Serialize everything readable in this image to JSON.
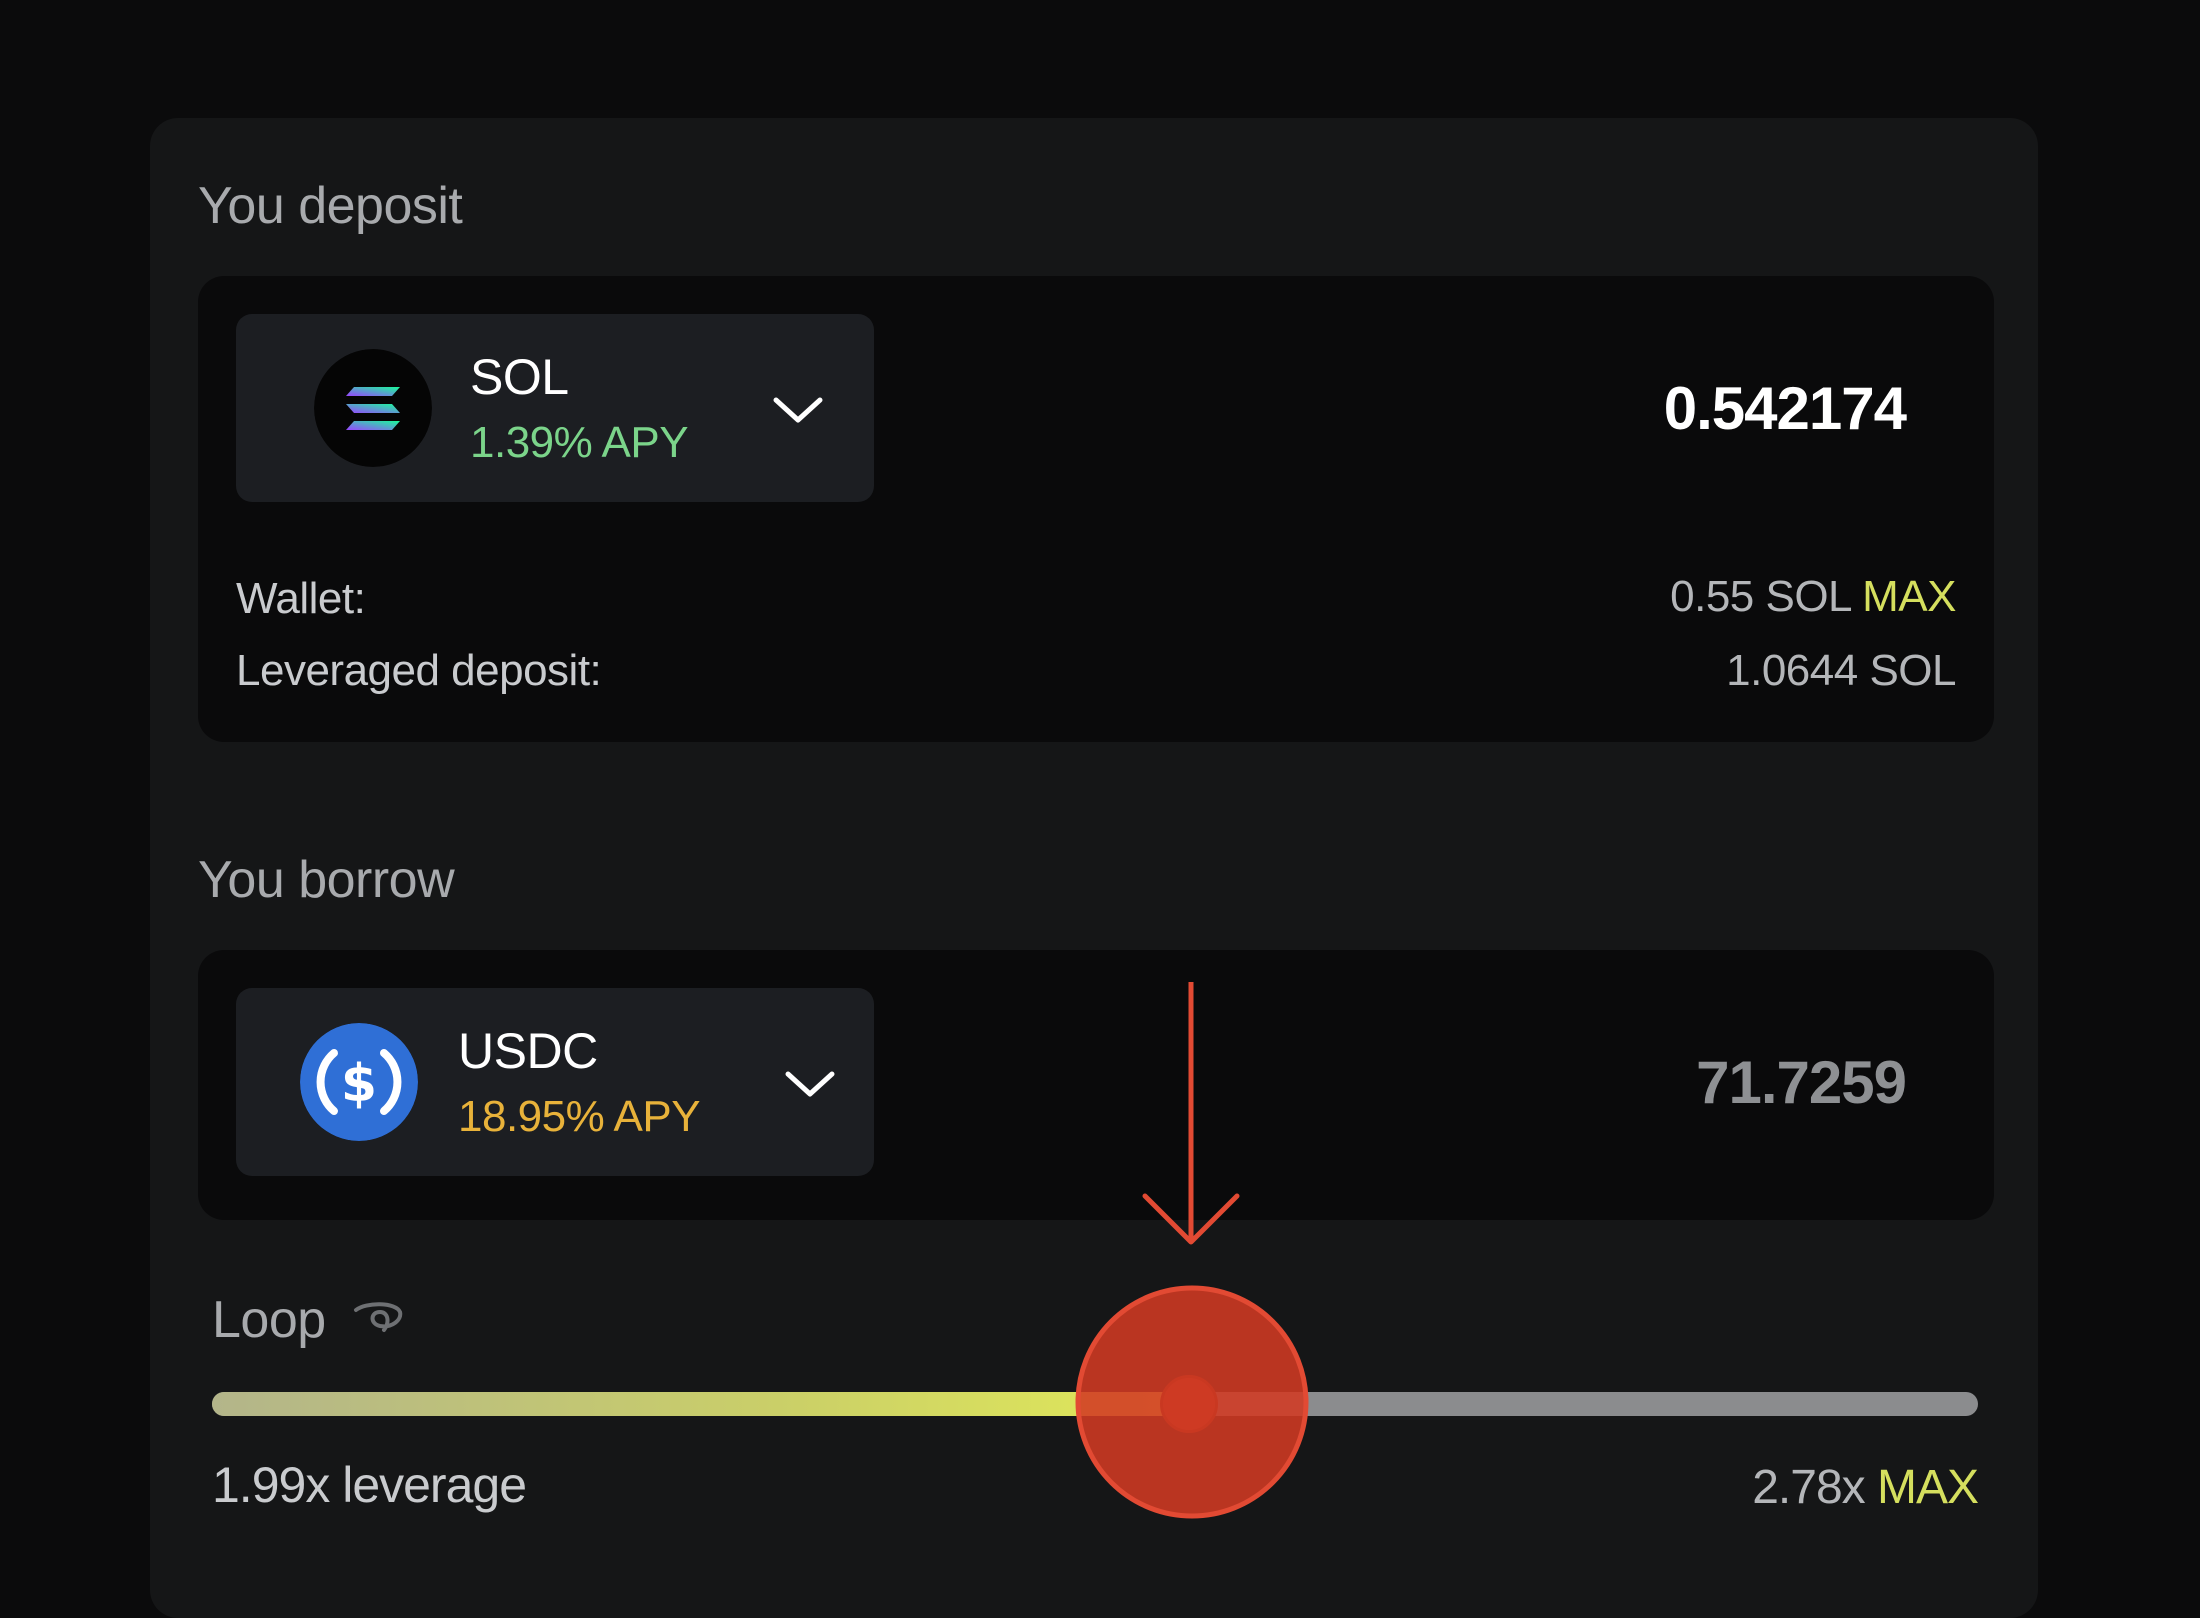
{
  "deposit": {
    "title": "You deposit",
    "token": {
      "symbol": "SOL",
      "apy": "1.39% APY",
      "icon": "solana-logo",
      "apy_color": "#7bd48a"
    },
    "amount": "0.542174",
    "wallet_label": "Wallet:",
    "wallet_value": "0.55 SOL",
    "wallet_max": "MAX",
    "leveraged_label": "Leveraged deposit:",
    "leveraged_value": "1.0644 SOL"
  },
  "borrow": {
    "title": "You borrow",
    "token": {
      "symbol": "USDC",
      "apy": "18.95% APY",
      "icon": "usdc-logo",
      "apy_color": "#e8b23a"
    },
    "amount": "71.7259"
  },
  "loop": {
    "title": "Loop",
    "icon": "loop-icon",
    "leverage": "1.99x leverage",
    "max_value": "2.78x",
    "max_label": "MAX",
    "slider_fraction": 0.553
  },
  "colors": {
    "accent_yellow": "#d5df5e",
    "overlay_red": "#e24a33"
  }
}
